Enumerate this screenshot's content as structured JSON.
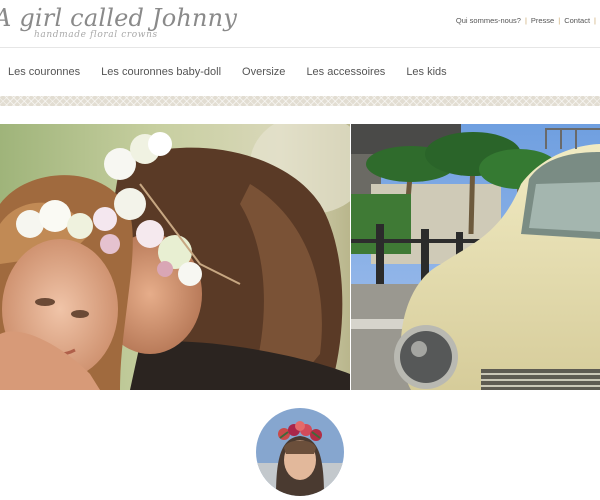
{
  "site": {
    "title": "A girl called Johnny",
    "tagline": "handmade floral crowns"
  },
  "utility_links": [
    "Qui sommes-nous?",
    "Presse",
    "Contact"
  ],
  "nav": {
    "items": [
      "Les couronnes",
      "Les couronnes baby-doll",
      "Oversize",
      "Les accessoires",
      "Les kids"
    ]
  },
  "colors": {
    "accent": "#c9a56a",
    "text": "#555555",
    "band": "#e2ddd2"
  },
  "images": {
    "hero_left": "woman-kissing-child-floral-crowns",
    "hero_right": "vintage-cream-car-palm-trees",
    "avatar": "girl-rose-crown-portrait"
  }
}
